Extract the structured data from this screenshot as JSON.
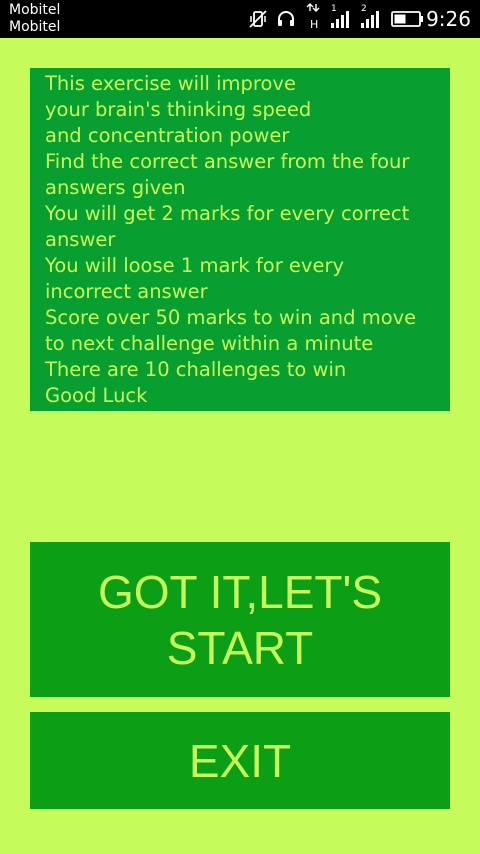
{
  "status_bar": {
    "carrier_line1": "Mobitel",
    "carrier_line2": "Mobitel",
    "net_badge": "H",
    "sim1_index": "1",
    "sim2_index": "2",
    "time": "9:26",
    "icons": [
      "vibrate-muted-icon",
      "headset-icon",
      "data-arrows-icon",
      "signal-icon",
      "signal-icon",
      "battery-icon"
    ]
  },
  "instructions": {
    "lines": [
      "This exercise will improve",
      "your brain's thinking speed",
      "and concentration power",
      "Find the correct answer from the four",
      "answers given",
      "You will get 2 marks for every correct",
      "answer",
      "You will loose 1 mark for every",
      "incorrect answer",
      "Score over 50 marks to win and move",
      "to next challenge within a minute",
      "There are 10 challenges to win",
      "Good Luck"
    ]
  },
  "buttons": {
    "start_line1": "GOT IT,LET'S",
    "start_line2": "START",
    "exit": "EXIT"
  },
  "colors": {
    "background": "#c6fb5c",
    "panel": "#089e30",
    "button": "#0c9e14",
    "text": "#c6fb5c"
  }
}
